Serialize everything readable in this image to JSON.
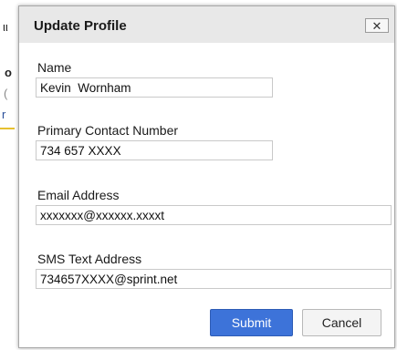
{
  "background": {
    "fragments": [
      "ιι",
      "o",
      "(",
      "r"
    ]
  },
  "dialog": {
    "title": "Update Profile",
    "close_icon": "close-icon",
    "fields": {
      "name": {
        "label": "Name",
        "value": "Kevin  Wornham"
      },
      "phone": {
        "label": "Primary Contact Number",
        "value": "734 657 XXXX"
      },
      "email": {
        "label": "Email Address",
        "value": "xxxxxxx@xxxxxx.xxxxt"
      },
      "sms": {
        "label": "SMS Text Address",
        "value": "734657XXXX@sprint.net"
      }
    },
    "buttons": {
      "submit": "Submit",
      "cancel": "Cancel"
    },
    "colors": {
      "submit_bg": "#3d73d9",
      "titlebar_bg": "#e8e8e8"
    }
  }
}
